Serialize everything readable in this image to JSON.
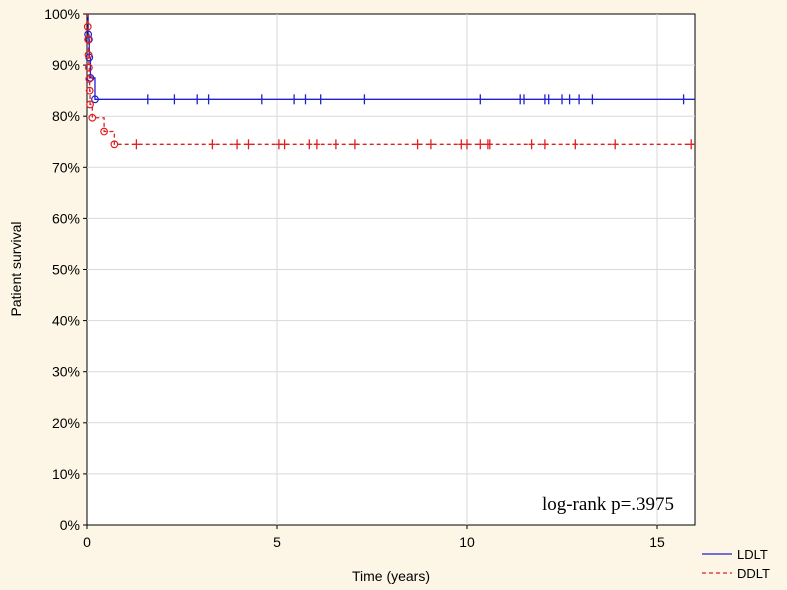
{
  "chart_data": {
    "type": "line",
    "title": "",
    "xlabel": "Time (years)",
    "ylabel": "Patient survival",
    "xlim": [
      0,
      16
    ],
    "ylim": [
      0,
      100
    ],
    "x_ticks": [
      0,
      5,
      10,
      15
    ],
    "x_tick_labels": [
      "0",
      "5",
      "10",
      "15"
    ],
    "y_ticks": [
      0,
      10,
      20,
      30,
      40,
      50,
      60,
      70,
      80,
      90,
      100
    ],
    "y_tick_labels": [
      "0%",
      "10%",
      "20%",
      "30%",
      "40%",
      "50%",
      "60%",
      "70%",
      "80%",
      "90%",
      "100%"
    ],
    "grid": true,
    "legend_position": "below-right",
    "annotation": "log-rank p=.3975",
    "series": [
      {
        "name": "LDLT",
        "color": "#2020d0",
        "line_style": "solid",
        "steps": [
          [
            0,
            100
          ],
          [
            0.03,
            96
          ],
          [
            0.05,
            95
          ],
          [
            0.06,
            91.5
          ],
          [
            0.09,
            87.5
          ],
          [
            0.21,
            83.3
          ],
          [
            16,
            83.3
          ]
        ],
        "events": [
          [
            0.03,
            96
          ],
          [
            0.05,
            95
          ],
          [
            0.06,
            91.5
          ],
          [
            0.09,
            87.5
          ],
          [
            0.21,
            83.3
          ]
        ],
        "censored": [
          1.6,
          2.3,
          2.9,
          3.2,
          4.6,
          5.45,
          5.75,
          6.15,
          7.3,
          10.35,
          11.4,
          11.5,
          12.05,
          12.15,
          12.5,
          12.7,
          12.95,
          13.3,
          15.7
        ]
      },
      {
        "name": "DDLT",
        "color": "#e02020",
        "line_style": "dashed",
        "steps": [
          [
            0,
            100
          ],
          [
            0.02,
            97.5
          ],
          [
            0.03,
            95
          ],
          [
            0.04,
            92
          ],
          [
            0.05,
            89.5
          ],
          [
            0.06,
            87.3
          ],
          [
            0.07,
            85
          ],
          [
            0.08,
            82.3
          ],
          [
            0.14,
            79.7
          ],
          [
            0.45,
            77
          ],
          [
            0.72,
            74.5
          ],
          [
            16,
            74.5
          ]
        ],
        "events": [
          [
            0.02,
            97.5
          ],
          [
            0.03,
            95
          ],
          [
            0.04,
            92
          ],
          [
            0.05,
            89.5
          ],
          [
            0.06,
            87.3
          ],
          [
            0.07,
            85
          ],
          [
            0.08,
            82.3
          ],
          [
            0.14,
            79.7
          ],
          [
            0.45,
            77
          ],
          [
            0.72,
            74.5
          ]
        ],
        "censored": [
          1.3,
          3.3,
          3.95,
          4.25,
          5.05,
          5.2,
          5.85,
          6.05,
          6.55,
          7.05,
          8.7,
          9.05,
          9.85,
          10.0,
          10.35,
          10.55,
          10.6,
          11.7,
          12.05,
          12.85,
          13.9,
          15.9
        ]
      }
    ]
  }
}
